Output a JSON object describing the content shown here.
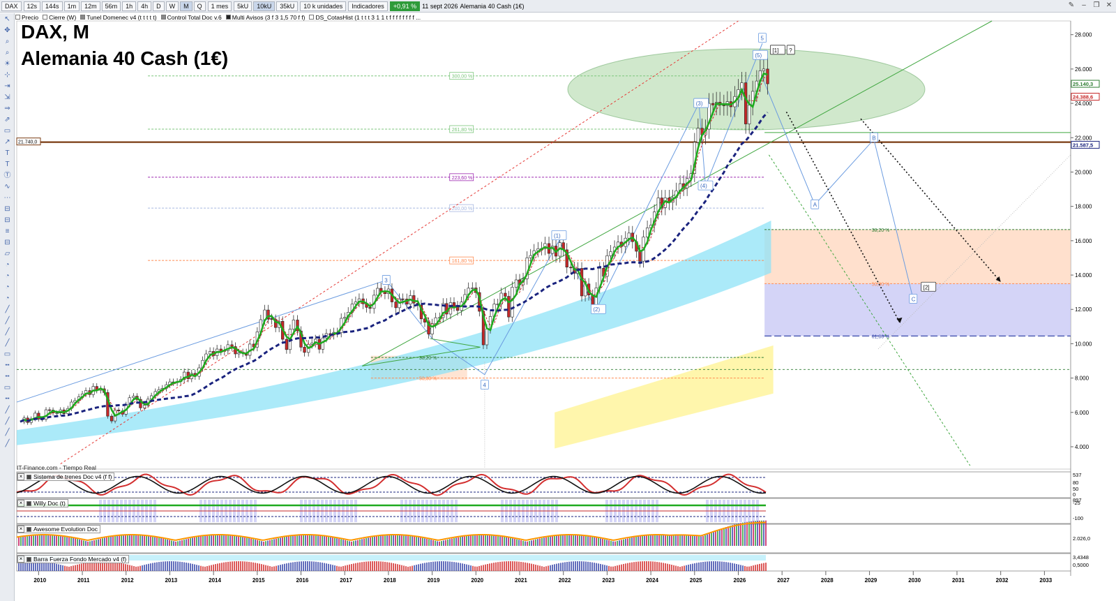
{
  "toolbar": {
    "symbol": "DAX",
    "timeframes": [
      "12s",
      "144s",
      "1m",
      "12m",
      "56m",
      "1h",
      "4h",
      "D",
      "W",
      "M",
      "Q"
    ],
    "active_timeframe": "M",
    "period": "1 mes",
    "units": [
      "5kU",
      "10kU",
      "35kU"
    ],
    "active_unit": "10kU",
    "quantity": "10 k unidades",
    "indicators_label": "Indicadores",
    "change_badge": "+0,91 %",
    "date": "11 sept 2026",
    "instrument": "Alemania 40 Cash (1€)"
  },
  "indicator_strip": [
    "Precio",
    "Cierre (W)",
    "Tunel Domenec v4 (t t t t t)",
    "Control Total Doc v.6",
    "Multi Avisos (3 f 3 1,5 70 f f)",
    "DS_CotasHist (1 t t t 3 1 1 t f f f f f f f f ..."
  ],
  "header": {
    "title_line1": "DAX, M",
    "title_line2": "Alemania 40 Cash (1€)"
  },
  "source_label": "IT-Finance.com - Tiempo Real",
  "panes": [
    {
      "label": "Sistema de trenes Doc v4 (f f)",
      "right_values": [
        "537",
        "80",
        "50",
        "0"
      ]
    },
    {
      "label": "Willy Doc (t)",
      "right_values": [
        "-25",
        "897",
        "-100"
      ]
    },
    {
      "label": "Awesome Evolution Doc",
      "right_values": [
        "2.026,0"
      ]
    },
    {
      "label": "Barra Fuerza Fondo Mercado v4 (f)",
      "right_values": [
        "3,4348",
        "0,5000"
      ]
    }
  ],
  "colors": {
    "bull": "#2e7d32",
    "bear": "#c62828",
    "ma_green": "#1faa1f",
    "ma_navy": "#1a237e",
    "fib_red": "#e53935",
    "band_cyan": "#8fe3f7",
    "band_yellow": "#fff59d",
    "band_orange": "#ffd8c0",
    "band_blue": "#c9c9f5",
    "horizontal_brown": "#7a3b12"
  },
  "chart_data": {
    "type": "candlestick",
    "title": "DAX, M",
    "subtitle": "Alemania 40 Cash (1€)",
    "x_ticks": [
      "2010",
      "2011",
      "2012",
      "2013",
      "2014",
      "2015",
      "2016",
      "2017",
      "2018",
      "2019",
      "2020",
      "2021",
      "2022",
      "2023",
      "2024",
      "2025",
      "2026",
      "2027",
      "2028",
      "2029",
      "2030",
      "2031",
      "2032",
      "2033"
    ],
    "y_ticks": [
      "4.000",
      "6.000",
      "8.000",
      "10.000",
      "12.000",
      "14.000",
      "16.000",
      "18.000",
      "20.000",
      "22.000",
      "24.000",
      "26.000",
      "28.000"
    ],
    "ylim": [
      2700,
      28800
    ],
    "price_tags": [
      {
        "label": "25.140,3",
        "value": 25140
      },
      {
        "label": "24.388,6",
        "value": 24388
      },
      {
        "label": "21.587,5",
        "value": 21587
      }
    ],
    "horizontal_level": {
      "label": "21.740,0",
      "value": 21740
    },
    "fib_extensions": [
      {
        "label": "300,00 %",
        "value": 25600
      },
      {
        "label": "261,80 %",
        "value": 22500
      },
      {
        "label": "223,60 %",
        "value": 19700
      },
      {
        "label": "200,00 %",
        "value": 17900
      },
      {
        "label": "161,80 %",
        "value": 14850
      }
    ],
    "fib_retracements_2018": [
      {
        "label": "38,20 %",
        "value": 9200
      },
      {
        "label": "50,00 %",
        "value": 8000
      }
    ],
    "fib_retracements_future": [
      {
        "label": "38,20 %",
        "value": 16650
      },
      {
        "label": "50,00 %",
        "value": 13500
      },
      {
        "label": "61,80 %",
        "value": 10450
      }
    ],
    "wave_labels": [
      {
        "label": "3",
        "date": 2017.95,
        "value": 13700
      },
      {
        "label": "4",
        "date": 2020.2,
        "value": 7600
      },
      {
        "label": "(1)",
        "date": 2021.9,
        "value": 16300
      },
      {
        "label": "(2)",
        "date": 2022.8,
        "value": 12000
      },
      {
        "label": "(3)",
        "date": 2025.15,
        "value": 24000
      },
      {
        "label": "(4)",
        "date": 2025.25,
        "value": 19200
      },
      {
        "label": "(5)",
        "date": 2026.5,
        "value": 26800
      },
      {
        "label": "5",
        "date": 2026.55,
        "value": 27800
      },
      {
        "label": "[1]",
        "date": 2026.9,
        "value": 27100
      },
      {
        "label": "?",
        "date": 2027.2,
        "value": 27100
      },
      {
        "label": "A",
        "date": 2027.75,
        "value": 18100
      },
      {
        "label": "B",
        "date": 2029.1,
        "value": 22000
      },
      {
        "label": "C",
        "date": 2030.0,
        "value": 12600
      },
      {
        "label": "[2]",
        "date": 2030.35,
        "value": 13300
      }
    ],
    "ohlc_monthly_close": [
      [
        2009.58,
        5458
      ],
      [
        2009.67,
        5675
      ],
      [
        2009.75,
        5414
      ],
      [
        2009.83,
        5625
      ],
      [
        2009.92,
        5957
      ],
      [
        2010.0,
        5608
      ],
      [
        2010.08,
        5598
      ],
      [
        2010.17,
        6153
      ],
      [
        2010.25,
        6135
      ],
      [
        2010.33,
        5964
      ],
      [
        2010.42,
        5965
      ],
      [
        2010.5,
        6147
      ],
      [
        2010.58,
        5925
      ],
      [
        2010.67,
        6229
      ],
      [
        2010.75,
        6601
      ],
      [
        2010.83,
        6688
      ],
      [
        2010.92,
        6914
      ],
      [
        2011.0,
        7077
      ],
      [
        2011.08,
        7272
      ],
      [
        2011.17,
        7041
      ],
      [
        2011.25,
        7514
      ],
      [
        2011.33,
        7293
      ],
      [
        2011.42,
        7376
      ],
      [
        2011.5,
        7158
      ],
      [
        2011.58,
        5784
      ],
      [
        2011.67,
        5502
      ],
      [
        2011.75,
        6141
      ],
      [
        2011.83,
        6088
      ],
      [
        2011.92,
        5898
      ],
      [
        2012.0,
        6458
      ],
      [
        2012.08,
        6856
      ],
      [
        2012.17,
        6946
      ],
      [
        2012.25,
        6761
      ],
      [
        2012.33,
        6264
      ],
      [
        2012.42,
        6416
      ],
      [
        2012.5,
        6772
      ],
      [
        2012.58,
        6970
      ],
      [
        2012.67,
        7216
      ],
      [
        2012.75,
        7326
      ],
      [
        2012.83,
        7405
      ],
      [
        2012.92,
        7612
      ],
      [
        2013.0,
        7776
      ],
      [
        2013.08,
        7741
      ],
      [
        2013.17,
        7795
      ],
      [
        2013.25,
        7914
      ],
      [
        2013.33,
        8348
      ],
      [
        2013.42,
        7959
      ],
      [
        2013.5,
        8276
      ],
      [
        2013.58,
        8103
      ],
      [
        2013.67,
        8594
      ],
      [
        2013.75,
        9033
      ],
      [
        2013.83,
        9406
      ],
      [
        2013.92,
        9552
      ],
      [
        2014.0,
        9306
      ],
      [
        2014.08,
        9692
      ],
      [
        2014.17,
        9556
      ],
      [
        2014.25,
        9603
      ],
      [
        2014.33,
        9943
      ],
      [
        2014.42,
        9833
      ],
      [
        2014.5,
        9407
      ],
      [
        2014.58,
        9470
      ],
      [
        2014.67,
        9474
      ],
      [
        2014.75,
        9326
      ],
      [
        2014.83,
        9981
      ],
      [
        2014.92,
        9806
      ],
      [
        2015.0,
        10694
      ],
      [
        2015.08,
        11401
      ],
      [
        2015.17,
        11966
      ],
      [
        2015.25,
        11454
      ],
      [
        2015.33,
        11413
      ],
      [
        2015.42,
        10945
      ],
      [
        2015.5,
        11308
      ],
      [
        2015.58,
        10259
      ],
      [
        2015.67,
        9660
      ],
      [
        2015.75,
        10850
      ],
      [
        2015.83,
        11382
      ],
      [
        2015.92,
        10743
      ],
      [
        2016.0,
        9798
      ],
      [
        2016.08,
        9495
      ],
      [
        2016.17,
        9965
      ],
      [
        2016.25,
        10038
      ],
      [
        2016.33,
        10262
      ],
      [
        2016.42,
        9680
      ],
      [
        2016.5,
        10337
      ],
      [
        2016.58,
        10592
      ],
      [
        2016.67,
        10511
      ],
      [
        2016.75,
        10665
      ],
      [
        2016.83,
        10640
      ],
      [
        2016.92,
        11481
      ],
      [
        2017.0,
        11535
      ],
      [
        2017.08,
        11834
      ],
      [
        2017.17,
        12312
      ],
      [
        2017.25,
        12438
      ],
      [
        2017.33,
        12615
      ],
      [
        2017.42,
        12325
      ],
      [
        2017.5,
        12118
      ],
      [
        2017.58,
        12055
      ],
      [
        2017.67,
        12828
      ],
      [
        2017.75,
        13229
      ],
      [
        2017.83,
        13023
      ],
      [
        2017.92,
        12917
      ],
      [
        2018.0,
        13189
      ],
      [
        2018.08,
        12435
      ],
      [
        2018.17,
        12096
      ],
      [
        2018.25,
        12612
      ],
      [
        2018.33,
        12604
      ],
      [
        2018.42,
        12306
      ],
      [
        2018.5,
        12805
      ],
      [
        2018.58,
        12364
      ],
      [
        2018.67,
        12246
      ],
      [
        2018.75,
        11447
      ],
      [
        2018.83,
        11257
      ],
      [
        2018.92,
        10558
      ],
      [
        2019.0,
        11173
      ],
      [
        2019.08,
        11515
      ],
      [
        2019.17,
        11526
      ],
      [
        2019.25,
        12344
      ],
      [
        2019.33,
        11726
      ],
      [
        2019.42,
        12398
      ],
      [
        2019.5,
        12189
      ],
      [
        2019.58,
        11939
      ],
      [
        2019.67,
        12428
      ],
      [
        2019.75,
        12866
      ],
      [
        2019.83,
        13236
      ],
      [
        2019.92,
        13249
      ],
      [
        2020.0,
        12981
      ],
      [
        2020.08,
        11890
      ],
      [
        2020.17,
        9936
      ],
      [
        2020.25,
        10862
      ],
      [
        2020.33,
        11587
      ],
      [
        2020.42,
        12311
      ],
      [
        2020.5,
        12313
      ],
      [
        2020.58,
        12945
      ],
      [
        2020.67,
        12761
      ],
      [
        2020.75,
        11556
      ],
      [
        2020.83,
        13291
      ],
      [
        2020.92,
        13719
      ],
      [
        2021.0,
        13432
      ],
      [
        2021.08,
        13786
      ],
      [
        2021.17,
        15008
      ],
      [
        2021.25,
        15136
      ],
      [
        2021.33,
        15421
      ],
      [
        2021.42,
        15531
      ],
      [
        2021.5,
        15544
      ],
      [
        2021.58,
        15835
      ],
      [
        2021.67,
        15261
      ],
      [
        2021.75,
        15688
      ],
      [
        2021.83,
        15100
      ],
      [
        2021.92,
        15885
      ],
      [
        2022.0,
        15471
      ],
      [
        2022.08,
        14461
      ],
      [
        2022.17,
        14415
      ],
      [
        2022.25,
        14098
      ],
      [
        2022.33,
        14388
      ],
      [
        2022.42,
        12784
      ],
      [
        2022.5,
        13484
      ],
      [
        2022.58,
        12835
      ],
      [
        2022.67,
        12114
      ],
      [
        2022.75,
        13253
      ],
      [
        2022.83,
        14397
      ],
      [
        2022.92,
        13924
      ],
      [
        2023.0,
        15128
      ],
      [
        2023.08,
        15365
      ],
      [
        2023.17,
        15629
      ],
      [
        2023.25,
        15922
      ],
      [
        2023.33,
        15664
      ],
      [
        2023.42,
        16148
      ],
      [
        2023.5,
        16447
      ],
      [
        2023.58,
        15947
      ],
      [
        2023.67,
        15386
      ],
      [
        2023.75,
        14810
      ],
      [
        2023.83,
        16215
      ],
      [
        2023.92,
        16752
      ],
      [
        2024.0,
        16904
      ],
      [
        2024.08,
        17678
      ],
      [
        2024.17,
        18492
      ],
      [
        2024.25,
        17932
      ],
      [
        2024.33,
        18498
      ],
      [
        2024.42,
        18235
      ],
      [
        2024.5,
        18509
      ],
      [
        2024.58,
        18907
      ],
      [
        2024.67,
        19325
      ],
      [
        2024.75,
        19078
      ],
      [
        2024.83,
        19626
      ],
      [
        2024.92,
        19909
      ],
      [
        2025.0,
        21732
      ],
      [
        2025.08,
        22551
      ],
      [
        2025.17,
        22163
      ],
      [
        2025.25,
        22497
      ],
      [
        2025.33,
        23997
      ],
      [
        2025.42,
        23909
      ],
      [
        2025.5,
        24065
      ],
      [
        2025.58,
        23902
      ],
      [
        2025.67,
        23880
      ],
      [
        2025.75,
        24100
      ],
      [
        2025.83,
        23800
      ],
      [
        2025.92,
        24400
      ],
      [
        2026.0,
        24800
      ],
      [
        2026.08,
        25200
      ],
      [
        2026.17,
        22800
      ],
      [
        2026.25,
        23900
      ],
      [
        2026.33,
        24700
      ],
      [
        2026.42,
        25300
      ],
      [
        2026.5,
        25900
      ],
      [
        2026.58,
        26000
      ],
      [
        2026.67,
        25140
      ]
    ]
  }
}
